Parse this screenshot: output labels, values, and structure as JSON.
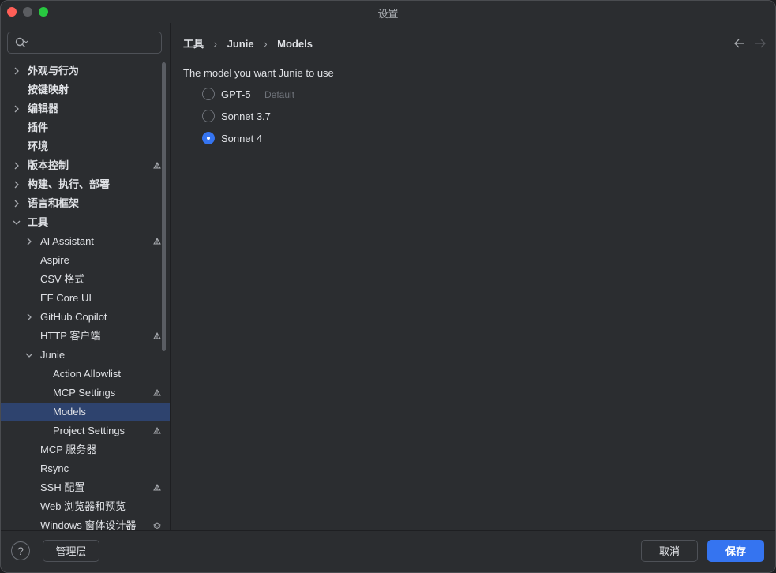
{
  "window": {
    "title": "设置"
  },
  "search": {
    "placeholder": "",
    "value": ""
  },
  "sidebar": {
    "items": [
      {
        "label": "外观与行为",
        "level": 0,
        "expandable": true,
        "expanded": false,
        "badge": "",
        "bold": true
      },
      {
        "label": "按键映射",
        "level": 0,
        "expandable": false,
        "expanded": false,
        "badge": "",
        "bold": true
      },
      {
        "label": "编辑器",
        "level": 0,
        "expandable": true,
        "expanded": false,
        "badge": "",
        "bold": true
      },
      {
        "label": "插件",
        "level": 0,
        "expandable": false,
        "expanded": false,
        "badge": "",
        "bold": true
      },
      {
        "label": "环境",
        "level": 0,
        "expandable": false,
        "expanded": false,
        "badge": "",
        "bold": true
      },
      {
        "label": "版本控制",
        "level": 0,
        "expandable": true,
        "expanded": false,
        "badge": "project-icon",
        "bold": true
      },
      {
        "label": "构建、执行、部署",
        "level": 0,
        "expandable": true,
        "expanded": false,
        "badge": "",
        "bold": true
      },
      {
        "label": "语言和框架",
        "level": 0,
        "expandable": true,
        "expanded": false,
        "badge": "",
        "bold": true
      },
      {
        "label": "工具",
        "level": 0,
        "expandable": true,
        "expanded": true,
        "badge": "",
        "bold": true
      },
      {
        "label": "AI Assistant",
        "level": 1,
        "expandable": true,
        "expanded": false,
        "badge": "project-icon",
        "bold": false
      },
      {
        "label": "Aspire",
        "level": 1,
        "expandable": false,
        "expanded": false,
        "badge": "",
        "bold": false
      },
      {
        "label": "CSV 格式",
        "level": 1,
        "expandable": false,
        "expanded": false,
        "badge": "",
        "bold": false
      },
      {
        "label": "EF Core UI",
        "level": 1,
        "expandable": false,
        "expanded": false,
        "badge": "",
        "bold": false
      },
      {
        "label": "GitHub Copilot",
        "level": 1,
        "expandable": true,
        "expanded": false,
        "badge": "",
        "bold": false
      },
      {
        "label": "HTTP 客户端",
        "level": 1,
        "expandable": false,
        "expanded": false,
        "badge": "project-icon",
        "bold": false
      },
      {
        "label": "Junie",
        "level": 1,
        "expandable": true,
        "expanded": true,
        "badge": "",
        "bold": false
      },
      {
        "label": "Action Allowlist",
        "level": 2,
        "expandable": false,
        "expanded": false,
        "badge": "",
        "bold": false
      },
      {
        "label": "MCP Settings",
        "level": 2,
        "expandable": false,
        "expanded": false,
        "badge": "project-icon",
        "bold": false
      },
      {
        "label": "Models",
        "level": 2,
        "expandable": false,
        "expanded": false,
        "badge": "",
        "bold": false,
        "selected": true
      },
      {
        "label": "Project Settings",
        "level": 2,
        "expandable": false,
        "expanded": false,
        "badge": "project-icon",
        "bold": false
      },
      {
        "label": "MCP 服务器",
        "level": 1,
        "expandable": false,
        "expanded": false,
        "badge": "",
        "bold": false
      },
      {
        "label": "Rsync",
        "level": 1,
        "expandable": false,
        "expanded": false,
        "badge": "",
        "bold": false
      },
      {
        "label": "SSH 配置",
        "level": 1,
        "expandable": false,
        "expanded": false,
        "badge": "project-icon",
        "bold": false
      },
      {
        "label": "Web 浏览器和预览",
        "level": 1,
        "expandable": false,
        "expanded": false,
        "badge": "",
        "bold": false
      },
      {
        "label": "Windows 窗体设计器",
        "level": 1,
        "expandable": false,
        "expanded": false,
        "badge": "layers-icon",
        "bold": false
      }
    ]
  },
  "breadcrumb": [
    "工具",
    "Junie",
    "Models"
  ],
  "models": {
    "group_title": "The model you want Junie to use",
    "options": [
      {
        "label": "GPT-5",
        "hint": "Default",
        "checked": false
      },
      {
        "label": "Sonnet 3.7",
        "hint": "",
        "checked": false
      },
      {
        "label": "Sonnet 4",
        "hint": "",
        "checked": true
      }
    ]
  },
  "footer": {
    "help": "?",
    "manage_label": "管理层",
    "cancel_label": "取消",
    "save_label": "保存"
  },
  "colors": {
    "accent": "#3574f0",
    "selection": "#2e436e",
    "background": "#2b2d30"
  }
}
